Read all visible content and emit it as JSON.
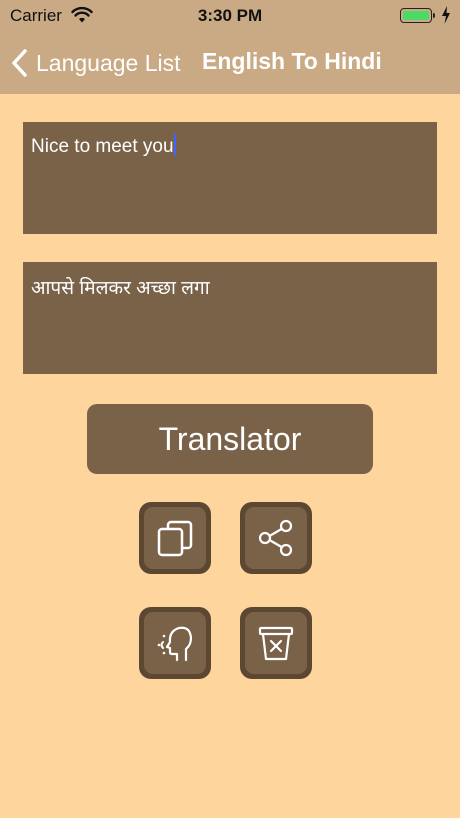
{
  "status": {
    "carrier": "Carrier",
    "time": "3:30 PM"
  },
  "nav": {
    "back_label": "Language List",
    "title": "English To Hindi"
  },
  "input": {
    "text": "Nice to meet you"
  },
  "output": {
    "text": "आपसे मिलकर अच्छा लगा"
  },
  "translate_label": "Translator",
  "colors": {
    "background": "#FFD59E",
    "bar": "#C9AA84",
    "panel": "#7A6249"
  },
  "icons": {
    "copy": "copy-icon",
    "share": "share-icon",
    "speak": "speak-icon",
    "clear": "clear-trash-icon"
  }
}
